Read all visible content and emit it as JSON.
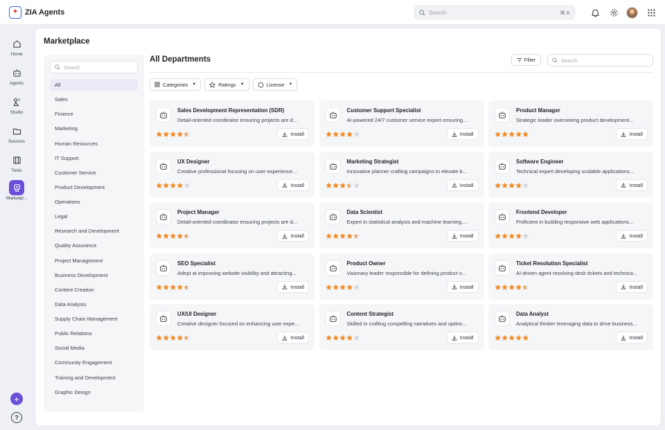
{
  "app": {
    "name": "ZIA Agents"
  },
  "topbar": {
    "search_placeholder": "Search",
    "shortcut": "⌘ K"
  },
  "rail": [
    {
      "label": "Home",
      "icon": "home-icon"
    },
    {
      "label": "Agents",
      "icon": "robot-icon"
    },
    {
      "label": "Studio",
      "icon": "studio-icon"
    },
    {
      "label": "Sources",
      "icon": "folder-icon"
    },
    {
      "label": "Tools",
      "icon": "tools-icon"
    },
    {
      "label": "Marketpl...",
      "icon": "marketplace-icon",
      "active": true
    }
  ],
  "page": {
    "title": "Marketplace"
  },
  "sidebar": {
    "search_placeholder": "Search",
    "items": [
      "All",
      "Sales",
      "Finance",
      "Marketing",
      "Human Resources",
      "IT Support",
      "Customer Service",
      "Product Development",
      "Operations",
      "Legal",
      "Research and Development",
      "Quality Assurance",
      "Project Management",
      "Business Development",
      "Content Creation",
      "Data Analysis",
      "Supply Chain Management",
      "Public Relations",
      "Social Media",
      "Community Engagement",
      "Training and Development",
      "Graphic Design"
    ],
    "active_index": 0
  },
  "content": {
    "title": "All Departments",
    "filter_label": "Filter",
    "search_placeholder": "Search",
    "chips": [
      {
        "label": "Categories",
        "icon": "grid-icon"
      },
      {
        "label": "Ratings",
        "icon": "star-outline-icon"
      },
      {
        "label": "License",
        "icon": "license-icon"
      }
    ]
  },
  "install_label": "Install",
  "colors": {
    "accent": "#6c4fd8",
    "star": "#f08a24",
    "star_empty": "#d4d6dc"
  },
  "agents": [
    {
      "title": "Sales Development Representation (SDR)",
      "desc": "Detail-oriented coordinator ensuring projects are d...",
      "rating": 4.5
    },
    {
      "title": "Customer Support Specialist",
      "desc": "AI-powered 24/7 customer service expert ensuring...",
      "rating": 4
    },
    {
      "title": "Product Manager",
      "desc": "Strategic leader overseeing product development...",
      "rating": 5
    },
    {
      "title": "UX Designer",
      "desc": "Creative professional focusing on user experience...",
      "rating": 4
    },
    {
      "title": "Marketing Strategist",
      "desc": "Innovative planner crafting campaigns to elevate b...",
      "rating": 3.5
    },
    {
      "title": "Software Engineer",
      "desc": "Technical expert developing scalable applications...",
      "rating": 4
    },
    {
      "title": "Project Manager",
      "desc": "Detail-oriented coordinator ensuring projects are d...",
      "rating": 4.5
    },
    {
      "title": "Data Scientist",
      "desc": "Expert in statistical analysis and machine learning,...",
      "rating": 4.5
    },
    {
      "title": "Frontend Developer",
      "desc": "Proficient in building responsive web applications...",
      "rating": 4
    },
    {
      "title": "SEO Specialist",
      "desc": "Adept at improving website visibility and attracting...",
      "rating": 4.5
    },
    {
      "title": "Product Owner",
      "desc": "Visionary leader responsible for defining product v...",
      "rating": 4
    },
    {
      "title": "Ticket Resolution Specialist",
      "desc": "AI-driven agent resolving desk tickets and technica...",
      "rating": 4.5
    },
    {
      "title": "UX/UI Designer",
      "desc": "Creative designer focused on enhancing user expe...",
      "rating": 4.5
    },
    {
      "title": "Content Strategist",
      "desc": "Skilled in crafting compelling narratives and optimi...",
      "rating": 4
    },
    {
      "title": "Data Analyst",
      "desc": "Analytical thinker leveraging data to drive business...",
      "rating": 5
    }
  ]
}
